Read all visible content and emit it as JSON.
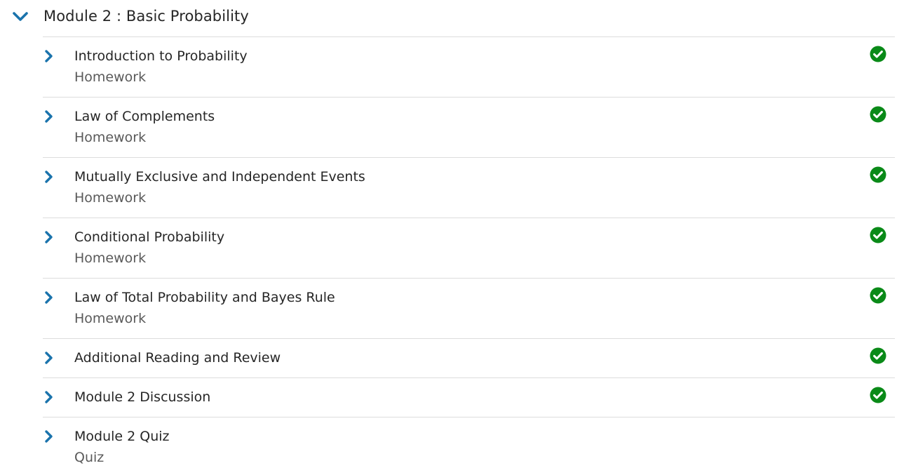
{
  "module": {
    "title": "Module 2 : Basic Probability",
    "expanded": true
  },
  "colors": {
    "chevron": "#1a73ac",
    "complete": "#0a8a18",
    "divider": "#dcdcdc",
    "title_text": "#262626",
    "type_text": "#5a5a5a"
  },
  "items": [
    {
      "title": "Introduction to Probability",
      "type": "Homework",
      "completed": true
    },
    {
      "title": "Law of Complements",
      "type": "Homework",
      "completed": true
    },
    {
      "title": "Mutually Exclusive and Independent Events",
      "type": "Homework",
      "completed": true
    },
    {
      "title": "Conditional Probability",
      "type": "Homework",
      "completed": true
    },
    {
      "title": "Law of Total Probability and Bayes Rule",
      "type": "Homework",
      "completed": true
    },
    {
      "title": "Additional Reading and Review",
      "type": "",
      "completed": true
    },
    {
      "title": "Module 2 Discussion",
      "type": "",
      "completed": true
    },
    {
      "title": "Module 2 Quiz",
      "type": "Quiz",
      "completed": false
    }
  ]
}
